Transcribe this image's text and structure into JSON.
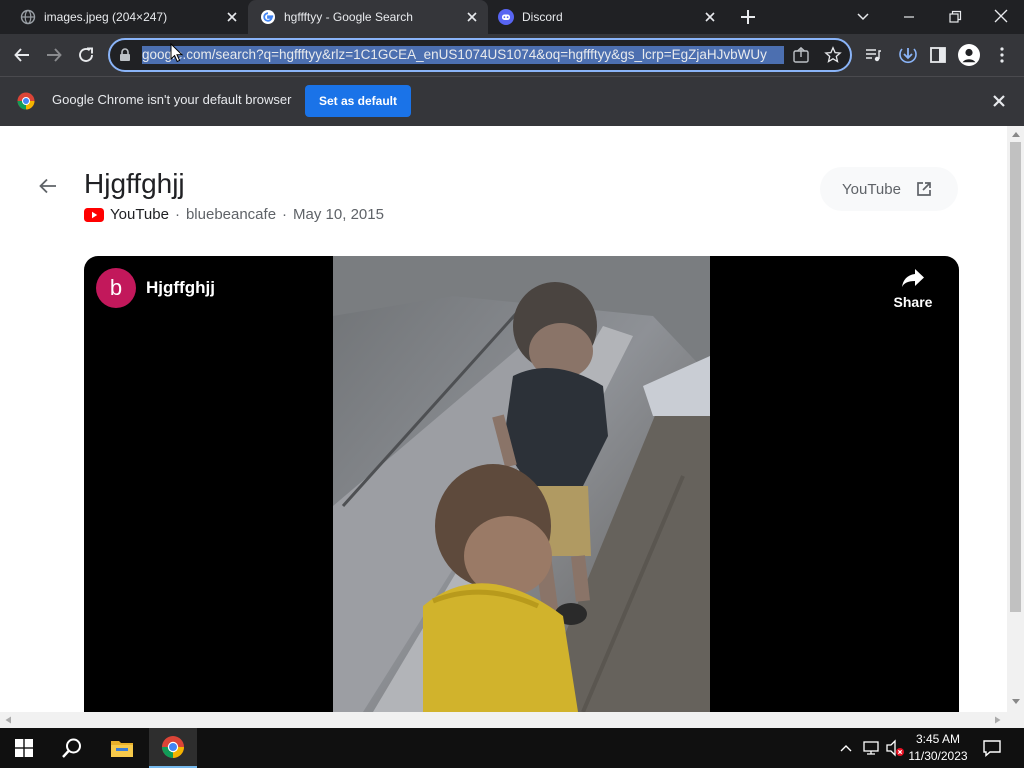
{
  "tabs": [
    {
      "title": "images.jpeg (204×247)",
      "favicon": "globe-icon"
    },
    {
      "title": "hgffftyy - Google Search",
      "favicon": "google-icon"
    },
    {
      "title": "Discord",
      "favicon": "discord-icon"
    }
  ],
  "omnibox": {
    "url": "google.com/search?q=hgffftyy&rlz=1C1GCEA_enUS1074US1074&oq=hgffftyy&gs_lcrp=EgZjaHJvbWUy"
  },
  "infobar": {
    "message": "Google Chrome isn't your default browser",
    "button": "Set as default"
  },
  "video": {
    "title": "Hjgffghjj",
    "source": "YouTube",
    "channel": "bluebeancafe",
    "date": "May 10, 2015",
    "separator": "·",
    "open_label": "YouTube",
    "player_title": "Hjgffghjj",
    "avatar_letter": "b",
    "share_label": "Share"
  },
  "clock": {
    "time": "3:45 AM",
    "date": "11/30/2023"
  },
  "colors": {
    "accent": "#1a73e8",
    "youtube": "#ff0000",
    "avatar": "#c2185b"
  }
}
